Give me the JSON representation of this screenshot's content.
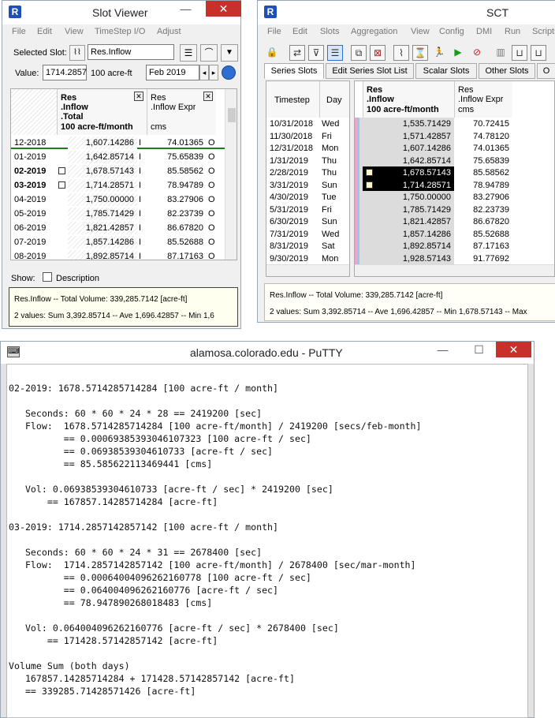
{
  "slot_viewer": {
    "title": "Slot Viewer",
    "menu": [
      "File",
      "Edit",
      "View",
      "TimeStep I/O",
      "Adjust"
    ],
    "selected_slot_label": "Selected Slot:",
    "selected_slot_value": "Res.Inflow",
    "value_label": "Value:",
    "value": "1714.2857",
    "unit": "100 acre-ft",
    "date": "Feb 2019",
    "col1_header": [
      "Res",
      ".Inflow",
      ".Total",
      "100 acre-ft/month"
    ],
    "col2_header": [
      "Res",
      ".Inflow Expr",
      "cms"
    ],
    "rows": [
      {
        "t": "12-2018",
        "v1": "1,607.14286",
        "f": "I",
        "v2": "74.01365",
        "o": "O",
        "bold": false,
        "icon": false
      },
      {
        "t": "01-2019",
        "v1": "1,642.85714",
        "f": "I",
        "v2": "75.65839",
        "o": "O",
        "bold": false,
        "icon": false
      },
      {
        "t": "02-2019",
        "v1": "1,678.57143",
        "f": "I",
        "v2": "85.58562",
        "o": "O",
        "bold": true,
        "icon": true
      },
      {
        "t": "03-2019",
        "v1": "1,714.28571",
        "f": "I",
        "v2": "78.94789",
        "o": "O",
        "bold": true,
        "icon": true
      },
      {
        "t": "04-2019",
        "v1": "1,750.00000",
        "f": "I",
        "v2": "83.27906",
        "o": "O",
        "bold": false,
        "icon": false
      },
      {
        "t": "05-2019",
        "v1": "1,785.71429",
        "f": "I",
        "v2": "82.23739",
        "o": "O",
        "bold": false,
        "icon": false
      },
      {
        "t": "06-2019",
        "v1": "1,821.42857",
        "f": "I",
        "v2": "86.67820",
        "o": "O",
        "bold": false,
        "icon": false
      },
      {
        "t": "07-2019",
        "v1": "1,857.14286",
        "f": "I",
        "v2": "85.52688",
        "o": "O",
        "bold": false,
        "icon": false
      },
      {
        "t": "08-2019",
        "v1": "1,892.85714",
        "f": "I",
        "v2": "87.17163",
        "o": "O",
        "bold": false,
        "icon": false
      }
    ],
    "show_label": "Show:",
    "description_label": "Description",
    "status_line1": "Res.Inflow -- Total Volume: 339,285.7142 [acre-ft]",
    "status_line2": "2 values:  Sum 3,392.85714 -- Ave 1,696.42857 -- Min 1,6"
  },
  "sct": {
    "title": "SCT",
    "menu": [
      "File",
      "Edit",
      "Slots",
      "Aggregation",
      "View",
      "Config",
      "DMI",
      "Run",
      "Scripts"
    ],
    "tabs": [
      "Series Slots",
      "Edit Series Slot List",
      "Scalar Slots",
      "Other Slots",
      "O"
    ],
    "timestep_header": "Timestep",
    "day_header": "Day",
    "col1_header": [
      "Res",
      ".Inflow",
      "100 acre-ft/month"
    ],
    "col2_header": [
      "Res",
      ".Inflow Expr",
      "cms"
    ],
    "rows": [
      {
        "t": "10/31/2018",
        "d": "Wed",
        "v1": "1,535.71429",
        "v2": "70.72415",
        "sel": false
      },
      {
        "t": "11/30/2018",
        "d": "Fri",
        "v1": "1,571.42857",
        "v2": "74.78120",
        "sel": false
      },
      {
        "t": "12/31/2018",
        "d": "Mon",
        "v1": "1,607.14286",
        "v2": "74.01365",
        "sel": false
      },
      {
        "t": "1/31/2019",
        "d": "Thu",
        "v1": "1,642.85714",
        "v2": "75.65839",
        "sel": false
      },
      {
        "t": "2/28/2019",
        "d": "Thu",
        "v1": "1,678.57143",
        "v2": "85.58562",
        "sel": true
      },
      {
        "t": "3/31/2019",
        "d": "Sun",
        "v1": "1,714.28571",
        "v2": "78.94789",
        "sel": true
      },
      {
        "t": "4/30/2019",
        "d": "Tue",
        "v1": "1,750.00000",
        "v2": "83.27906",
        "sel": false
      },
      {
        "t": "5/31/2019",
        "d": "Fri",
        "v1": "1,785.71429",
        "v2": "82.23739",
        "sel": false
      },
      {
        "t": "6/30/2019",
        "d": "Sun",
        "v1": "1,821.42857",
        "v2": "86.67820",
        "sel": false
      },
      {
        "t": "7/31/2019",
        "d": "Wed",
        "v1": "1,857.14286",
        "v2": "85.52688",
        "sel": false
      },
      {
        "t": "8/31/2019",
        "d": "Sat",
        "v1": "1,892.85714",
        "v2": "87.17163",
        "sel": false
      },
      {
        "t": "9/30/2019",
        "d": "Mon",
        "v1": "1,928.57143",
        "v2": "91.77692",
        "sel": false
      }
    ],
    "status_line1": "Res.Inflow -- Total Volume: 339,285.7142 [acre-ft]",
    "status_line2": "2 values:  Sum 3,392.85714 -- Ave 1,696.42857 -- Min 1,678.57143 -- Max"
  },
  "putty": {
    "title": "alamosa.colorado.edu - PuTTY",
    "text": "02-2019: 1678.5714285714284 [100 acre-ft / month]\n\n   Seconds: 60 * 60 * 24 * 28 == 2419200 [sec]\n   Flow:  1678.5714285714284 [100 acre-ft/month] / 2419200 [secs/feb-month]\n          == 0.00069385393046107323 [100 acre-ft / sec]\n          == 0.06938539304610733 [acre-ft / sec]\n          == 85.585622113469441 [cms]\n\n   Vol: 0.06938539304610733 [acre-ft / sec] * 2419200 [sec]\n       == 167857.14285714284 [acre-ft]\n\n03-2019: 1714.2857142857142 [100 acre-ft / month]\n\n   Seconds: 60 * 60 * 24 * 31 == 2678400 [sec]\n   Flow:  1714.2857142857142 [100 acre-ft/month] / 2678400 [sec/mar-month]\n          == 0.00064004096262160778 [100 acre-ft / sec]\n          == 0.064004096262160776 [acre-ft / sec]\n          == 78.947890268018483 [cms]\n\n   Vol: 0.064004096262160776 [acre-ft / sec] * 2678400 [sec]\n       == 171428.57142857142 [acre-ft]\n\nVolume Sum (both days)\n   167857.14285714284 + 171428.57142857142 [acre-ft]\n   == 339285.71428571426 [acre-ft]"
  },
  "icons": {
    "minimize": "—",
    "maximize": "☐",
    "close": "✕",
    "menu": "☰",
    "plot": "📈",
    "down": "▼",
    "left": "◂",
    "right": "▸",
    "globe": "🌐",
    "flag": "▪"
  },
  "colors": {
    "title_close": "#c7312b",
    "selection": "#000000",
    "accent_green": "#1a7f1a",
    "logo_blue": "#1e4fb8"
  }
}
